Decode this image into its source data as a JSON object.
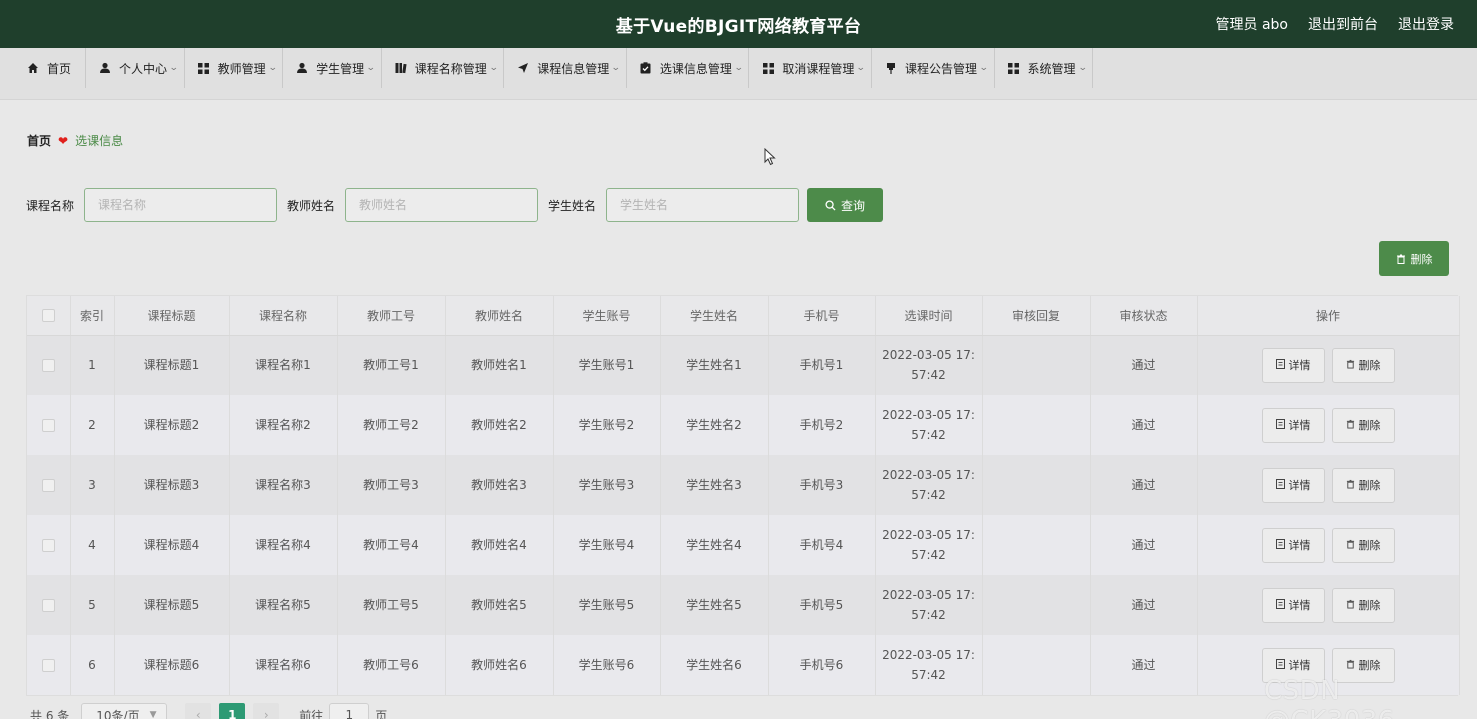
{
  "header": {
    "title": "基于Vue的BJGIT网络教育平台",
    "user": "管理员 abo",
    "to_front": "退出到前台",
    "logout": "退出登录"
  },
  "nav": {
    "items": [
      {
        "label": "首页",
        "icon": "home-icon"
      },
      {
        "label": "个人中心",
        "icon": "user-icon"
      },
      {
        "label": "教师管理",
        "icon": "grid-icon"
      },
      {
        "label": "学生管理",
        "icon": "user-icon"
      },
      {
        "label": "课程名称管理",
        "icon": "book-icon"
      },
      {
        "label": "课程信息管理",
        "icon": "send-icon"
      },
      {
        "label": "选课信息管理",
        "icon": "clipboard-check-icon"
      },
      {
        "label": "取消课程管理",
        "icon": "grid-icon"
      },
      {
        "label": "课程公告管理",
        "icon": "pin-icon"
      },
      {
        "label": "系统管理",
        "icon": "grid-icon"
      }
    ]
  },
  "breadcrumb": {
    "home": "首页",
    "current": "选课信息"
  },
  "search": {
    "course_label": "课程名称",
    "course_placeholder": "课程名称",
    "teacher_label": "教师姓名",
    "teacher_placeholder": "教师姓名",
    "student_label": "学生姓名",
    "student_placeholder": "学生姓名",
    "query_label": "查询"
  },
  "toolbar": {
    "delete_label": "删除"
  },
  "table": {
    "columns": [
      "索引",
      "课程标题",
      "课程名称",
      "教师工号",
      "教师姓名",
      "学生账号",
      "学生姓名",
      "手机号",
      "选课时间",
      "审核回复",
      "审核状态",
      "操作"
    ],
    "rows": [
      {
        "index": "1",
        "title": "课程标题1",
        "course": "课程名称1",
        "teacher_no": "教师工号1",
        "teacher": "教师姓名1",
        "student_no": "学生账号1",
        "student": "学生姓名1",
        "phone": "手机号1",
        "time_a": "2022-03-05 17:",
        "time_b": "57:42",
        "reply": "",
        "status": "通过"
      },
      {
        "index": "2",
        "title": "课程标题2",
        "course": "课程名称2",
        "teacher_no": "教师工号2",
        "teacher": "教师姓名2",
        "student_no": "学生账号2",
        "student": "学生姓名2",
        "phone": "手机号2",
        "time_a": "2022-03-05 17:",
        "time_b": "57:42",
        "reply": "",
        "status": "通过"
      },
      {
        "index": "3",
        "title": "课程标题3",
        "course": "课程名称3",
        "teacher_no": "教师工号3",
        "teacher": "教师姓名3",
        "student_no": "学生账号3",
        "student": "学生姓名3",
        "phone": "手机号3",
        "time_a": "2022-03-05 17:",
        "time_b": "57:42",
        "reply": "",
        "status": "通过"
      },
      {
        "index": "4",
        "title": "课程标题4",
        "course": "课程名称4",
        "teacher_no": "教师工号4",
        "teacher": "教师姓名4",
        "student_no": "学生账号4",
        "student": "学生姓名4",
        "phone": "手机号4",
        "time_a": "2022-03-05 17:",
        "time_b": "57:42",
        "reply": "",
        "status": "通过"
      },
      {
        "index": "5",
        "title": "课程标题5",
        "course": "课程名称5",
        "teacher_no": "教师工号5",
        "teacher": "教师姓名5",
        "student_no": "学生账号5",
        "student": "学生姓名5",
        "phone": "手机号5",
        "time_a": "2022-03-05 17:",
        "time_b": "57:42",
        "reply": "",
        "status": "通过"
      },
      {
        "index": "6",
        "title": "课程标题6",
        "course": "课程名称6",
        "teacher_no": "教师工号6",
        "teacher": "教师姓名6",
        "student_no": "学生账号6",
        "student": "学生姓名6",
        "phone": "手机号6",
        "time_a": "2022-03-05 17:",
        "time_b": "57:42",
        "reply": "",
        "status": "通过"
      }
    ],
    "detail_label": "详情",
    "delete_label": "删除"
  },
  "pager": {
    "total": "共 6 条",
    "page_size": "10条/页",
    "current_page": "1",
    "goto_label": "前往",
    "goto_value": "1",
    "page_suffix": "页"
  },
  "watermark": "CSDN @CK3036",
  "colors": {
    "header_bg": "#1f3f2c",
    "accent_green": "#4d8b4a",
    "page_active": "#2d9a74",
    "heart": "#e0201c"
  }
}
